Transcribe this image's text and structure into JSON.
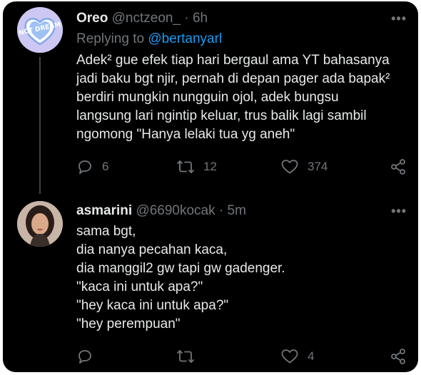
{
  "colors": {
    "background": "#000000",
    "text_primary": "#e7e9ea",
    "text_secondary": "#71767b",
    "link": "#1d9bf0"
  },
  "tweets": [
    {
      "name": "Oreo",
      "handle": "@nctzeon_",
      "separator": "·",
      "time": "6h",
      "reply_prefix": "Replying to ",
      "reply_to": "@bertanyarl",
      "text": "Adek² gue efek tiap hari bergaul ama YT bahasanya\njadi baku bgt njir, pernah di depan pager ada bapak²\nberdiri mungkin nungguin ojol, adek bungsu\nlangsung lari ngintip keluar, trus balik lagi sambil\nngomong \"Hanya lelaki tua yg aneh\"",
      "more_label": "•••",
      "avatar_icon": "nct-dream-heart-logo",
      "logo_text": "NCT DREAM",
      "actions": {
        "reply_count": "6",
        "retweet_count": "12",
        "like_count": "374"
      }
    },
    {
      "name": "asmarini",
      "handle": "@6690kocak",
      "separator": "·",
      "time": "5m",
      "text": "sama bgt,\ndia nanya pecahan kaca,\ndia manggil2 gw tapi gw gadenger.\n\"kaca ini untuk apa?\"\n\"hey kaca ini untuk apa?\"\n\"hey perempuan\"",
      "more_label": "•••",
      "avatar_icon": "user-photo",
      "actions": {
        "reply_count": "",
        "retweet_count": "",
        "like_count": "4"
      }
    }
  ]
}
